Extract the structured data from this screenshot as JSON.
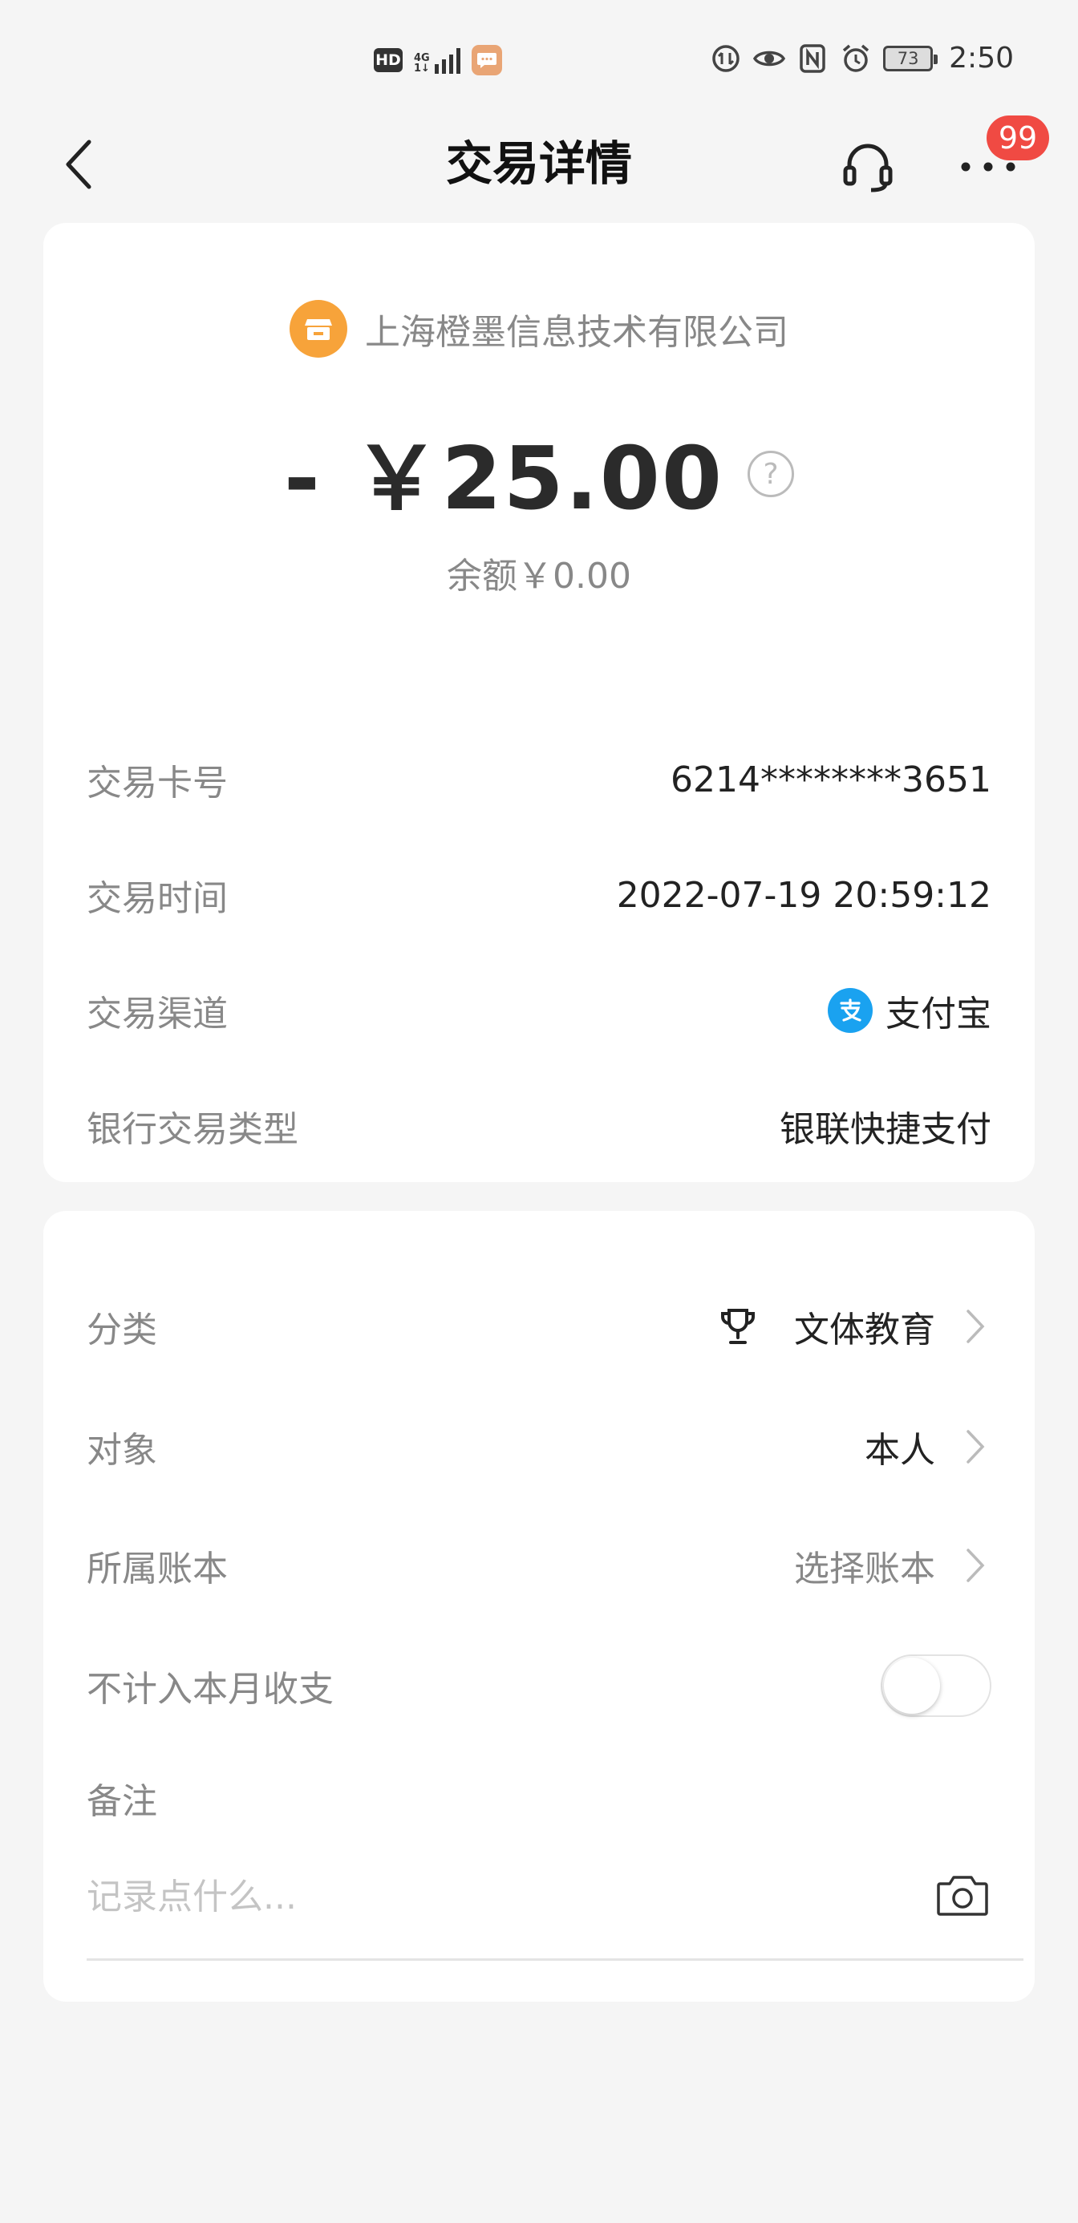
{
  "status_bar": {
    "hd_label": "HD",
    "network_label": "4G",
    "battery": "73",
    "time": "2:50"
  },
  "nav": {
    "title": "交易详情",
    "badge_count": "99"
  },
  "transaction": {
    "merchant": "上海橙墨信息技术有限公司",
    "amount": "- ￥25.00",
    "help_glyph": "?",
    "balance": "余额￥0.00",
    "details": [
      {
        "label": "交易卡号",
        "value": "6214********3651"
      },
      {
        "label": "交易时间",
        "value": "2022-07-19 20:59:12"
      },
      {
        "label": "交易渠道",
        "value": "支付宝"
      },
      {
        "label": "银行交易类型",
        "value": "银联快捷支付"
      }
    ]
  },
  "settings": {
    "category_label": "分类",
    "category_value": "文体教育",
    "target_label": "对象",
    "target_value": "本人",
    "ledger_label": "所属账本",
    "ledger_value": "选择账本",
    "exclude_label": "不计入本月收支",
    "exclude_on": false,
    "note_label": "备注",
    "note_placeholder": "记录点什么...",
    "note_value": ""
  },
  "colors": {
    "accent_orange": "#f7a33a",
    "badge_red": "#f04a43",
    "alipay_blue": "#1aa2f0"
  }
}
